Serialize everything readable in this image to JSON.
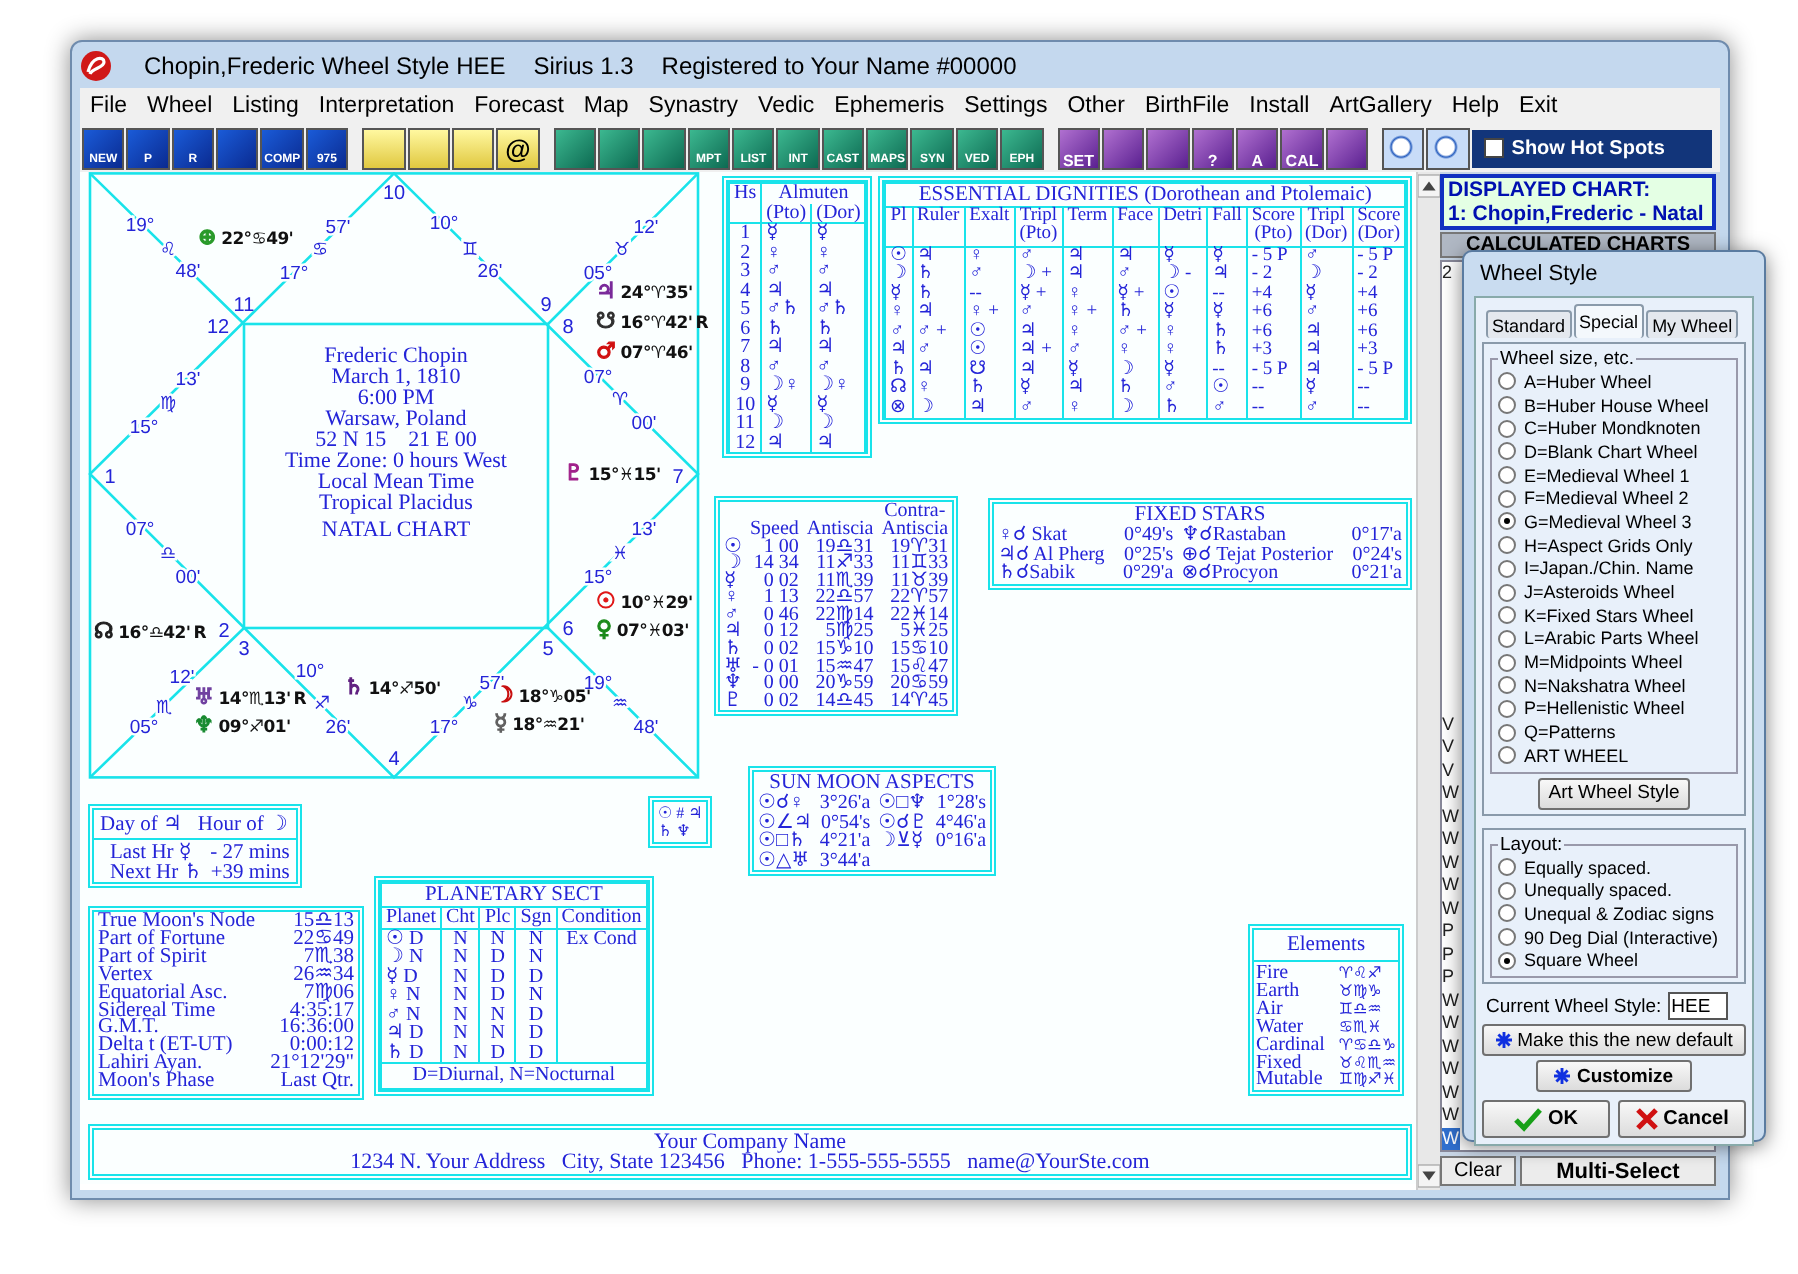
{
  "window": {
    "title": "Chopin,Frederic Wheel Style HEE",
    "version": "Sirius 1.3",
    "registration": "Registered to Your Name #00000"
  },
  "menu": [
    "File",
    "Wheel",
    "Listing",
    "Interpretation",
    "Forecast",
    "Map",
    "Synastry",
    "Vedic",
    "Ephemeris",
    "Settings",
    "Other",
    "BirthFile",
    "Install",
    "ArtGallery",
    "Help",
    "Exit"
  ],
  "toolbar": [
    {
      "kind": "blue",
      "label": "NEW"
    },
    {
      "kind": "blue",
      "label": "P"
    },
    {
      "kind": "blue",
      "label": "R"
    },
    {
      "kind": "blue"
    },
    {
      "kind": "blue",
      "label": "COMP"
    },
    {
      "kind": "blue",
      "label": "975"
    },
    {
      "kind": "yellow"
    },
    {
      "kind": "yellow"
    },
    {
      "kind": "yellow"
    },
    {
      "kind": "yellow",
      "label": "@"
    },
    {
      "kind": "green"
    },
    {
      "kind": "green"
    },
    {
      "kind": "green"
    },
    {
      "kind": "green",
      "label": "MPT"
    },
    {
      "kind": "green",
      "label": "LIST"
    },
    {
      "kind": "green",
      "label": "INT"
    },
    {
      "kind": "green",
      "label": "CAST"
    },
    {
      "kind": "green",
      "label": "MAPS"
    },
    {
      "kind": "green",
      "label": "SYN"
    },
    {
      "kind": "green",
      "label": "VED"
    },
    {
      "kind": "green",
      "label": "EPH"
    },
    {
      "kind": "purple",
      "label": "SET"
    },
    {
      "kind": "purple"
    },
    {
      "kind": "purple"
    },
    {
      "kind": "purple",
      "label": "?"
    },
    {
      "kind": "purple",
      "label": "A"
    },
    {
      "kind": "purple",
      "label": "CAL"
    },
    {
      "kind": "purple"
    },
    {
      "kind": "zoom"
    },
    {
      "kind": "zoom"
    }
  ],
  "hot_spots": {
    "label": "Show Hot Spots",
    "checked": false
  },
  "square_chart": {
    "house_numbers": [
      "10",
      "11",
      "12",
      "1",
      "2",
      "3",
      "4",
      "5",
      "6",
      "7",
      "8",
      "9"
    ],
    "cusps": [
      [
        "19°",
        "♌",
        "48'"
      ],
      [
        "57'",
        "♋",
        "17°"
      ],
      [
        "10°",
        "♊",
        "26'"
      ],
      [
        "12'",
        "♉",
        "05°"
      ],
      [
        "13'",
        "♍",
        "15°"
      ],
      [
        "07°",
        "♈",
        "00'"
      ],
      [
        "07°",
        "♎",
        "00'"
      ],
      [
        "13'",
        "♓",
        "15°"
      ],
      [
        "12'",
        "♏",
        "05°"
      ],
      [
        "10°",
        "♐",
        "26'"
      ],
      [
        "57'",
        "♑",
        "17°"
      ],
      [
        "19°",
        "♒",
        "48'"
      ]
    ],
    "planets": [
      {
        "glyph": "⊕",
        "position": "22°♋49'",
        "color": "#2a9a2a"
      },
      {
        "glyph": "♃",
        "position": "24°♈35'",
        "color": "#7a2a9a"
      },
      {
        "glyph": "☋",
        "position": "16°♈42'",
        "retro": "R",
        "color": "#303030"
      },
      {
        "glyph": "♂",
        "position": "07°♈46'",
        "color": "#d01010"
      },
      {
        "glyph": "♇",
        "position": "15°♓15'",
        "color": "#a0208a"
      },
      {
        "glyph": "☉",
        "position": "10°♓29'",
        "color": "#e01818"
      },
      {
        "glyph": "♀",
        "position": "07°♓03'",
        "color": "#1a8a1a"
      },
      {
        "glyph": "☊",
        "position": "16°♎42'",
        "retro": "R",
        "color": "#202020"
      },
      {
        "glyph": "♅",
        "position": "14°♏13'",
        "retro": "R",
        "color": "#7040a0"
      },
      {
        "glyph": "♆",
        "position": "09°♐01'",
        "color": "#188a30"
      },
      {
        "glyph": "♄",
        "position": "14°♐50'",
        "color": "#602080"
      },
      {
        "glyph": "☽",
        "position": "18°♑05'",
        "color": "#c81010"
      },
      {
        "glyph": "☿",
        "position": "18°♒21'",
        "color": "#606060"
      }
    ],
    "center_lines": [
      "Frederic Chopin",
      "March 1, 1810",
      "6:00 PM",
      "Warsaw, Poland",
      "52 N 15    21 E 00",
      "Time Zone: 0 hours West",
      "Local Mean Time",
      "Tropical Placidus"
    ],
    "chart_type": "NATAL CHART"
  },
  "house_almuten": {
    "header": [
      "Hs",
      "Almuten"
    ],
    "subheader": [
      "(Pto)",
      "(Dor)"
    ],
    "rows": [
      [
        "1",
        "☿",
        "☿"
      ],
      [
        "2",
        "♀",
        "♀"
      ],
      [
        "3",
        "♂",
        "♂"
      ],
      [
        "4",
        "♃",
        "♃"
      ],
      [
        "5",
        "♂♄",
        "♂♄"
      ],
      [
        "6",
        "♄",
        "♄"
      ],
      [
        "7",
        "♃",
        "♃"
      ],
      [
        "8",
        "♂",
        "♂"
      ],
      [
        "9",
        "☽♀",
        "☽♀"
      ],
      [
        "10",
        "☿",
        "☿"
      ],
      [
        "11",
        "☽",
        "☽"
      ],
      [
        "12",
        "♃",
        "♃"
      ]
    ]
  },
  "essential_dignities": {
    "title": "ESSENTIAL DIGNITIES  (Dorothean and Ptolemaic)",
    "columns": [
      "Pl",
      "Ruler",
      "Exalt",
      "Tripl (Pto)",
      "Term",
      "Face",
      "Detri",
      "Fall",
      "Score (Pto)",
      "Tripl (Dor)",
      "Score (Dor)"
    ],
    "rows": [
      [
        "☉",
        "♃",
        "♀",
        "♂",
        "♃",
        "♃",
        "☿",
        "☿",
        "- 5 P",
        "♂",
        "- 5 P"
      ],
      [
        "☽",
        "♄",
        "♂",
        "☽ +",
        "♃",
        "♂",
        "☽ -",
        "♃",
        "- 2",
        "☽",
        "- 2"
      ],
      [
        "☿",
        "♄",
        "--",
        "☿ +",
        "♀",
        "☿ +",
        "☉",
        "--",
        "+4",
        "☿",
        "+4"
      ],
      [
        "♀",
        "♃",
        "♀ +",
        "♂",
        "♀ +",
        "♄",
        "☿",
        "☿",
        "+6",
        "♂",
        "+6"
      ],
      [
        "♂",
        "♂ +",
        "☉",
        "♃",
        "♀",
        "♂ +",
        "♀",
        "♄",
        "+6",
        "♃",
        "+6"
      ],
      [
        "♃",
        "♂",
        "☉",
        "♃ +",
        "♂",
        "♀",
        "♀",
        "♄",
        "+3",
        "♃",
        "+3"
      ],
      [
        "♄",
        "♃",
        "☋",
        "♃",
        "☿",
        "☽",
        "☿",
        "--",
        "- 5 P",
        "♃",
        "- 5 P"
      ],
      [
        "☊",
        "♀",
        "♄",
        "☿",
        "♃",
        "♄",
        "♂",
        "☉",
        "--",
        "☿",
        "--"
      ],
      [
        "⊗",
        "☽",
        "♃",
        "♂",
        "♀",
        "☽",
        "♄",
        "♂",
        "--",
        "♂",
        "--"
      ]
    ]
  },
  "speed_antiscia": {
    "columns": [
      "",
      "Speed",
      "Antiscia",
      "Contra-Antiscia"
    ],
    "rows": [
      [
        "☉",
        "1 00",
        "19♎31",
        "19♈31"
      ],
      [
        "☽",
        "14 34",
        "11♐33",
        "11♊33"
      ],
      [
        "☿",
        "0 02",
        "11♏39",
        "11♉39"
      ],
      [
        "♀",
        "1 13",
        "22♎57",
        "22♈57"
      ],
      [
        "♂",
        "0 46",
        "22♍14",
        "22♓14"
      ],
      [
        "♃",
        "0 12",
        "5♍25",
        "5♓25"
      ],
      [
        "♄",
        "0 02",
        "15♑10",
        "15♋10"
      ],
      [
        "♅",
        "- 0 01",
        "15♒47",
        "15♌47"
      ],
      [
        "♆",
        "0 00",
        "20♑59",
        "20♋59"
      ],
      [
        "♇",
        "0 02",
        "14♎45",
        "14♈45"
      ]
    ]
  },
  "fixed_stars": {
    "title": "FIXED STARS",
    "rows": [
      [
        "♀☌ Skat",
        "0°49's",
        "♆☌Rastaban",
        "0°17'a"
      ],
      [
        "♃☌ Al Pherg",
        "0°25's",
        "⊕☌ Tejat Posterior",
        "0°24's"
      ],
      [
        "♄☌Sabik",
        "0°29'a",
        "⊗☌Procyon",
        "0°21'a"
      ]
    ]
  },
  "sun_moon_aspects": {
    "title": "SUN MOON ASPECTS",
    "rows": [
      [
        "☉☌♀",
        "3°26'a",
        "☉□♆",
        "1°28's"
      ],
      [
        "☉∠♃",
        "0°54's",
        "☉☌♇",
        "4°46'a"
      ],
      [
        "☉□♄",
        "4°21'a",
        "☽⊻☿",
        "0°16'a"
      ],
      [
        "☉△♅",
        "3°44'a"
      ]
    ]
  },
  "glyph_box": {
    "lines": [
      "☉ # ♃",
      "♄ ♆"
    ]
  },
  "planetary_hours": {
    "titles": [
      "Day of ♃",
      "Hour of ☽"
    ],
    "rows": [
      [
        "Last Hr ☿",
        "- 27 mins"
      ],
      [
        "Next Hr ♄",
        "+39 mins"
      ]
    ]
  },
  "chart_points": [
    [
      "True Moon's Node",
      "15♎13"
    ],
    [
      "Part of Fortune",
      "22♋49"
    ],
    [
      "Part of Spirit",
      "7♏38"
    ],
    [
      "Vertex",
      "26♒34"
    ],
    [
      "Equatorial Asc.",
      "7♍06"
    ],
    [
      "Sidereal Time",
      "4:35:17"
    ],
    [
      "G.M.T.",
      "16:36:00"
    ],
    [
      "Delta t (ET-UT)",
      "0:00:12"
    ],
    [
      "Lahiri Ayan.",
      "21°12'29\""
    ],
    [
      "Moon's Phase",
      "Last Qtr."
    ]
  ],
  "planetary_sect": {
    "title": "PLANETARY SECT",
    "columns": [
      "Planet",
      "Cht",
      "Plc",
      "Sgn",
      "Condition"
    ],
    "rows": [
      {
        "cells": [
          "☉ D",
          "N",
          "N",
          "N"
        ],
        "condition": "Ex Cond"
      },
      {
        "cells": [
          "☽ N",
          "N",
          "D",
          "N"
        ]
      },
      {
        "cells": [
          "☿ D",
          "N",
          "D",
          "D"
        ]
      },
      {
        "cells": [
          "♀ N",
          "N",
          "D",
          "N"
        ]
      },
      {
        "cells": [
          "♂ N",
          "N",
          "N",
          "D"
        ]
      },
      {
        "cells": [
          "♃ D",
          "N",
          "N",
          "D"
        ]
      },
      {
        "cells": [
          "♄ D",
          "N",
          "D",
          "D"
        ]
      }
    ],
    "legend": "D=Diurnal, N=Nocturnal"
  },
  "elements": {
    "title": "Elements",
    "rows": [
      [
        "Fire",
        "♈♌♐"
      ],
      [
        "Earth",
        "♉♍♑"
      ],
      [
        "Air",
        "♊♎♒"
      ],
      [
        "Water",
        "♋♏♓"
      ],
      [
        "Cardinal",
        "♈♋♎♑"
      ],
      [
        "Fixed",
        "♉♌♏♒"
      ],
      [
        "Mutable",
        "♊♍♐♓"
      ]
    ]
  },
  "footer": {
    "company": "Your Company Name",
    "address": "1234 N. Your Address   City, State 123456   Phone: 1-555-555-5555   name@YourSte.com"
  },
  "side_panel": {
    "displayed_label": "DISPLAYED CHART:",
    "displayed_chart": "1: Chopin,Frederic - Natal",
    "list_header": "CALCULATED CHARTS",
    "top_item": "2",
    "items": [
      {
        "label": "V",
        "selected": false
      },
      {
        "label": "V",
        "selected": false
      },
      {
        "label": "V",
        "selected": false
      },
      {
        "label": "W",
        "selected": false
      },
      {
        "label": "W",
        "selected": false
      },
      {
        "label": "W",
        "selected": false
      },
      {
        "label": "W",
        "selected": false
      },
      {
        "label": "W",
        "selected": false
      },
      {
        "label": "W",
        "selected": false
      },
      {
        "label": "P",
        "selected": false
      },
      {
        "label": "P",
        "selected": false
      },
      {
        "label": "P",
        "selected": false
      },
      {
        "label": "W",
        "selected": false
      },
      {
        "label": "W",
        "selected": false
      },
      {
        "label": "W",
        "selected": false
      },
      {
        "label": "W",
        "selected": false
      },
      {
        "label": "W",
        "selected": false
      },
      {
        "label": "W",
        "selected": false
      },
      {
        "label": "W",
        "selected": true
      }
    ],
    "buttons": [
      "Clear",
      "Multi-Select"
    ]
  },
  "wheel_style_dialog": {
    "title": "Wheel Style",
    "tabs": [
      {
        "label": "Standard",
        "selected": false
      },
      {
        "label": "Special",
        "selected": true
      },
      {
        "label": "My Wheel",
        "selected": false
      }
    ],
    "size_group": {
      "label": "Wheel size, etc.",
      "options": [
        {
          "label": "A=Huber Wheel",
          "selected": false
        },
        {
          "label": "B=Huber House Wheel",
          "selected": false
        },
        {
          "label": "C=Huber Mondknoten",
          "selected": false
        },
        {
          "label": "D=Blank Chart Wheel",
          "selected": false
        },
        {
          "label": "E=Medieval Wheel 1",
          "selected": false
        },
        {
          "label": "F=Medieval Wheel 2",
          "selected": false
        },
        {
          "label": "G=Medieval Wheel 3",
          "selected": true
        },
        {
          "label": "H=Aspect Grids Only",
          "selected": false
        },
        {
          "label": "I=Japan./Chin. Name",
          "selected": false
        },
        {
          "label": "J=Asteroids Wheel",
          "selected": false
        },
        {
          "label": "K=Fixed Stars Wheel",
          "selected": false
        },
        {
          "label": "L=Arabic Parts Wheel",
          "selected": false
        },
        {
          "label": "M=Midpoints Wheel",
          "selected": false
        },
        {
          "label": "N=Nakshatra Wheel",
          "selected": false
        },
        {
          "label": "P=Hellenistic Wheel",
          "selected": false
        },
        {
          "label": "Q=Patterns",
          "selected": false
        },
        {
          "label": "ART WHEEL",
          "selected": false
        }
      ]
    },
    "art_button": "Art Wheel Style",
    "layout_group": {
      "label": "Layout:",
      "options": [
        {
          "label": "Equally spaced.",
          "selected": false
        },
        {
          "label": "Unequally spaced.",
          "selected": false
        },
        {
          "label": "Unequal & Zodiac signs",
          "selected": false
        },
        {
          "label": "90 Deg Dial (Interactive)",
          "selected": false
        },
        {
          "label": "Square Wheel",
          "selected": true
        }
      ]
    },
    "current_style": {
      "label": "Current Wheel Style:",
      "value": "HEE"
    },
    "default_button": "Make this the new default",
    "customize_button": "Customize",
    "ok_button": "OK",
    "cancel_button": "Cancel"
  }
}
